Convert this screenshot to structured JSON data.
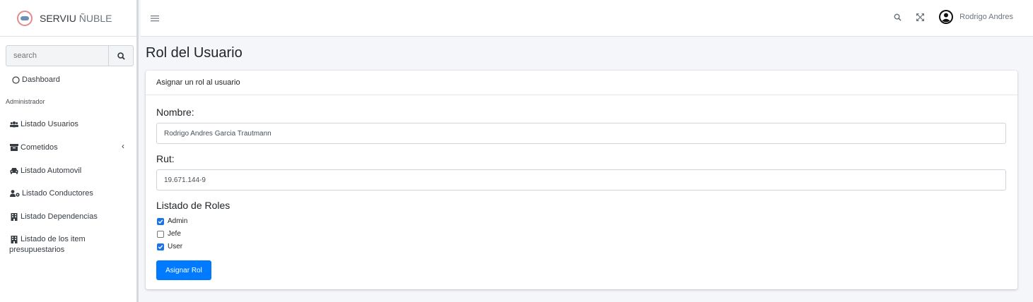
{
  "brand": {
    "name_bold": "SERVIU",
    "name_thin": "ÑUBLE"
  },
  "sidebar": {
    "search_placeholder": "search",
    "dashboard": "Dashboard",
    "section_header": "Administrador",
    "items": [
      {
        "label": "Listado Usuarios",
        "icon": "users-icon"
      },
      {
        "label": "Cometidos",
        "icon": "archive-icon"
      },
      {
        "label": "Listado Automovil",
        "icon": "car-icon"
      },
      {
        "label": "Listado Conductores",
        "icon": "user-cog-icon"
      },
      {
        "label": "Listado Dependencias",
        "icon": "building-icon"
      },
      {
        "label_line1": "Listado de los item",
        "label_line2": "presupuestarios",
        "icon": "building-icon"
      }
    ]
  },
  "topbar": {
    "user_name": "Rodrigo Andres"
  },
  "page": {
    "title": "Rol del Usuario"
  },
  "card": {
    "header": "Asignar un rol al usuario",
    "nombre_label": "Nombre:",
    "nombre_value": "Rodrigo Andres Garcia Trautmann",
    "rut_label": "Rut:",
    "rut_value": "19.671.144-9",
    "roles_label": "Listado de Roles",
    "roles": [
      {
        "label": "Admin",
        "checked": true
      },
      {
        "label": "Jefe",
        "checked": false
      },
      {
        "label": "User",
        "checked": true
      }
    ],
    "submit_label": "Asignar Rol"
  },
  "colors": {
    "primary": "#007bff",
    "checkbox": "#1a73e8",
    "background": "#f4f6f9"
  }
}
